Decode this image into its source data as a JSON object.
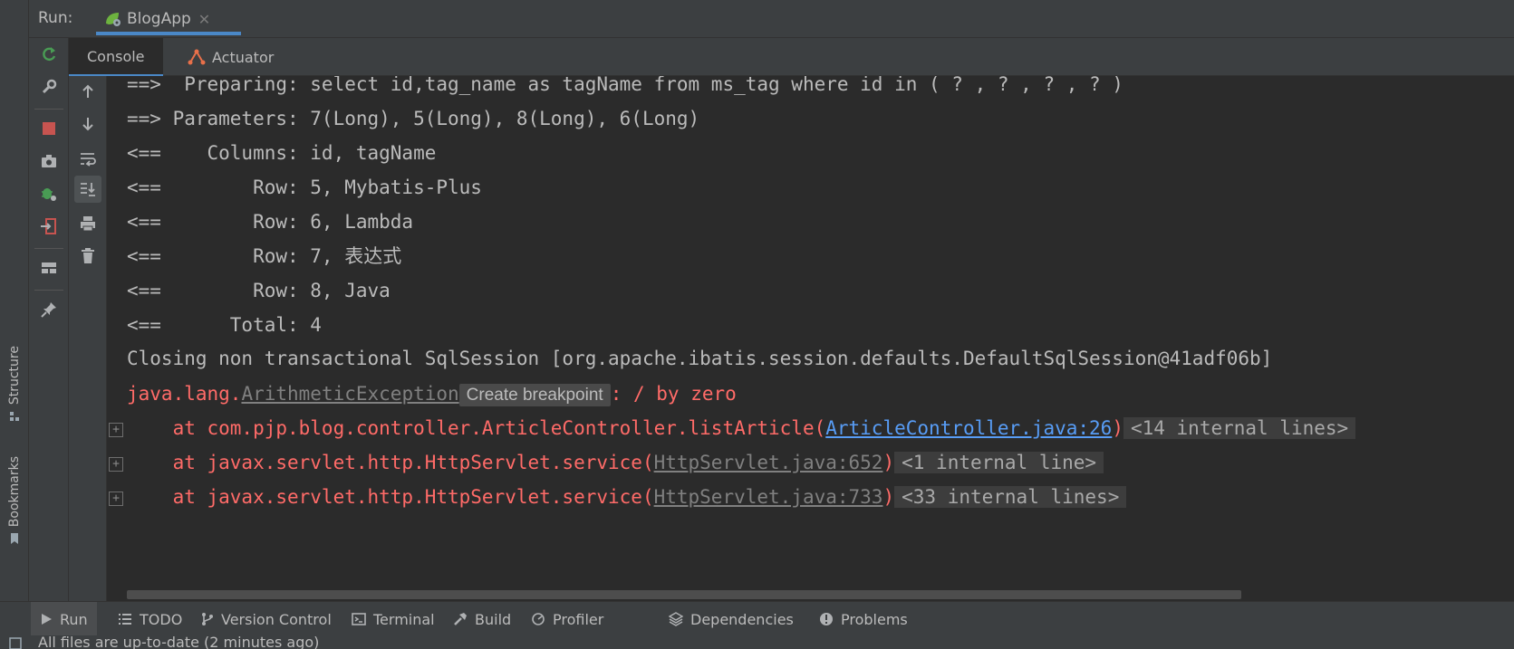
{
  "run_panel": {
    "label": "Run:",
    "tab_title": "BlogApp",
    "close_glyph": "✕"
  },
  "console_tabs": [
    {
      "label": "Console",
      "icon": "console"
    },
    {
      "label": "Actuator",
      "icon": "actuator-icon"
    }
  ],
  "side_tabs": {
    "structure": "Structure",
    "bookmarks": "Bookmarks"
  },
  "colors": {
    "accent": "#4a88c7",
    "error": "#ff6b68",
    "link": "#589df6",
    "run_green": "#499c54",
    "stop_red": "#c75450"
  },
  "console": {
    "lines": [
      "==>  Preparing: select id,tag_name as tagName from ms_tag where id in ( ? , ? , ? , ? )",
      "==> Parameters: 7(Long), 5(Long), 8(Long), 6(Long)",
      "<==    Columns: id, tagName",
      "<==        Row: 5, Mybatis-Plus",
      "<==        Row: 6, Lambda",
      "<==        Row: 7, 表达式",
      "<==        Row: 8, Java",
      "<==      Total: 4",
      "Closing non transactional SqlSession [org.apache.ibatis.session.defaults.DefaultSqlSession@41adf06b]"
    ],
    "exception": {
      "prefix": "java.lang.",
      "class_name": "ArithmeticException",
      "tooltip": "Create breakpoint",
      "message": ": / by zero"
    },
    "stack": [
      {
        "text": "    at com.pjp.blog.controller.ArticleController.listArticle(",
        "link": "ArticleController.java:26",
        "suffix": ")",
        "internal": "<14 internal lines>"
      },
      {
        "text": "    at javax.servlet.http.HttpServlet.service(",
        "link": "HttpServlet.java:652",
        "suffix": ")",
        "internal": "<1 internal line>"
      },
      {
        "text": "    at javax.servlet.http.HttpServlet.service(",
        "link": "HttpServlet.java:733",
        "suffix": ")",
        "internal": "<33 internal lines>"
      }
    ]
  },
  "tool_windows": [
    {
      "label": "Run",
      "icon": "play-icon"
    },
    {
      "label": "TODO",
      "icon": "list-icon"
    },
    {
      "label": "Version Control",
      "icon": "branch-icon"
    },
    {
      "label": "Terminal",
      "icon": "terminal-icon"
    },
    {
      "label": "Build",
      "icon": "hammer-icon"
    },
    {
      "label": "Profiler",
      "icon": "profiler-icon"
    },
    {
      "label": "Dependencies",
      "icon": "layers-icon"
    },
    {
      "label": "Problems",
      "icon": "info-icon"
    }
  ],
  "status": {
    "text": "All files are up-to-date (2 minutes ago)"
  }
}
